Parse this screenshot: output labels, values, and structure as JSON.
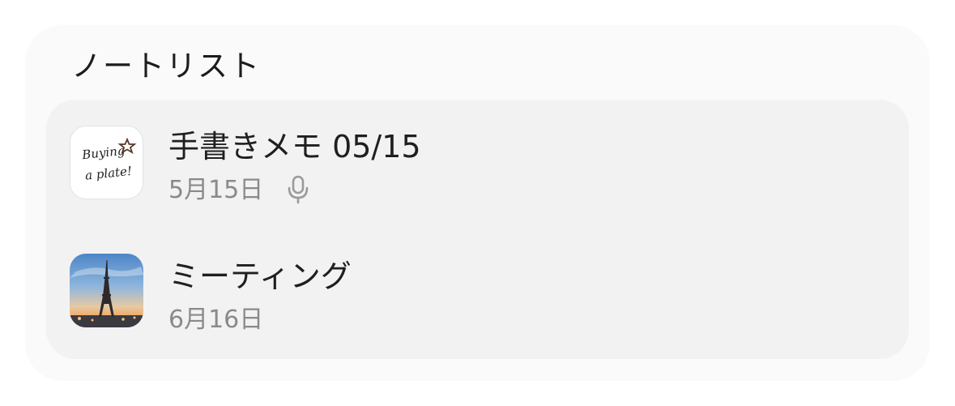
{
  "section": {
    "title": "ノートリスト"
  },
  "notes": [
    {
      "title": "手書きメモ 05/15",
      "date": "5月15日",
      "thumbnail_text": [
        "Buying",
        "a plate!"
      ],
      "has_voice": true,
      "voice_icon": "microphone-icon"
    },
    {
      "title": "ミーティング",
      "date": "6月16日",
      "thumbnail_image": "eiffel-tower-photo"
    }
  ],
  "colors": {
    "card_bg": "#fafafa",
    "list_bg": "#f2f2f2",
    "title_text": "#1f1f1f",
    "secondary_text": "#8a8a8a"
  }
}
